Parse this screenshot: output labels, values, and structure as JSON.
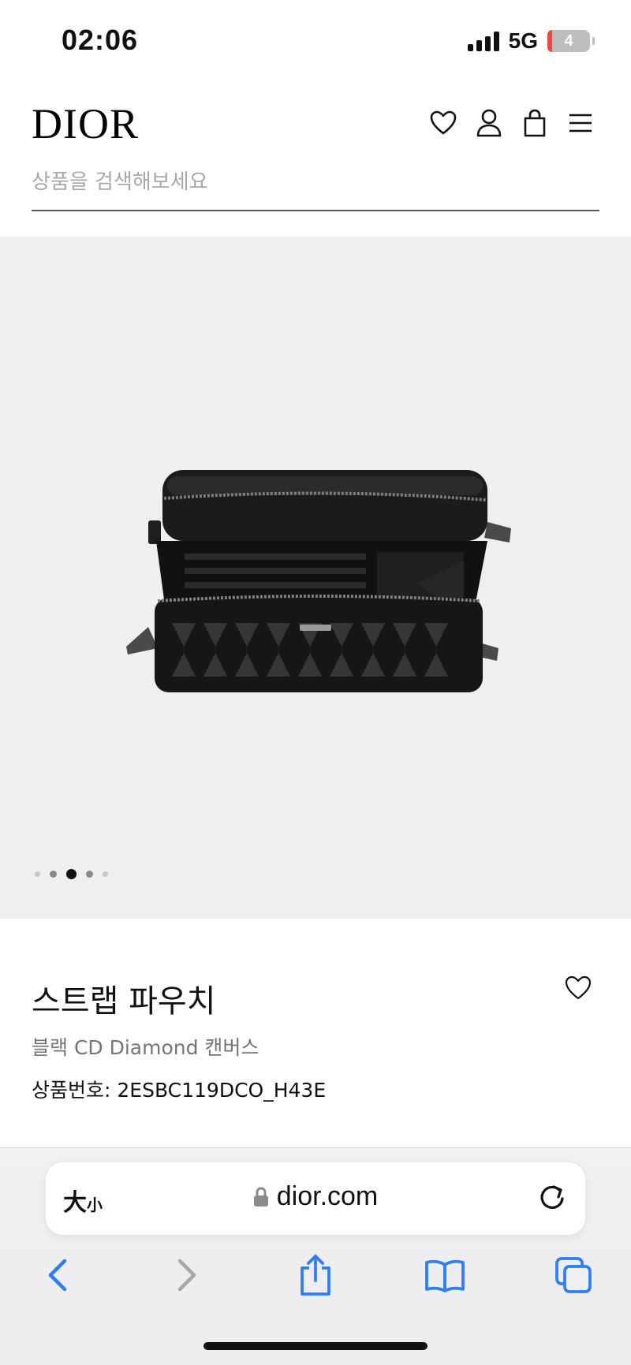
{
  "status_bar": {
    "time": "02:06",
    "network": "5G",
    "battery": "4"
  },
  "header": {
    "logo": "DIOR",
    "icons": [
      "heart-icon",
      "account-icon",
      "shopping-bag-icon",
      "menu-icon"
    ]
  },
  "search": {
    "placeholder": "상품을 검색해보세요"
  },
  "gallery": {
    "dots_total": 5,
    "active_dot": 3
  },
  "product": {
    "title": "스트랩 파우치",
    "subtitle": "블랙 CD Diamond 캔버스",
    "reference": "상품번호: 2ESBC119DCO_H43E"
  },
  "browser": {
    "text_size_big": "大",
    "text_size_small": "小",
    "url": "dior.com",
    "toolbar": [
      "back-icon",
      "forward-icon",
      "share-icon",
      "bookmarks-icon",
      "tabs-icon"
    ]
  },
  "colors": {
    "accent": "#2f7ef6",
    "gallery_bg": "#efeff2"
  }
}
